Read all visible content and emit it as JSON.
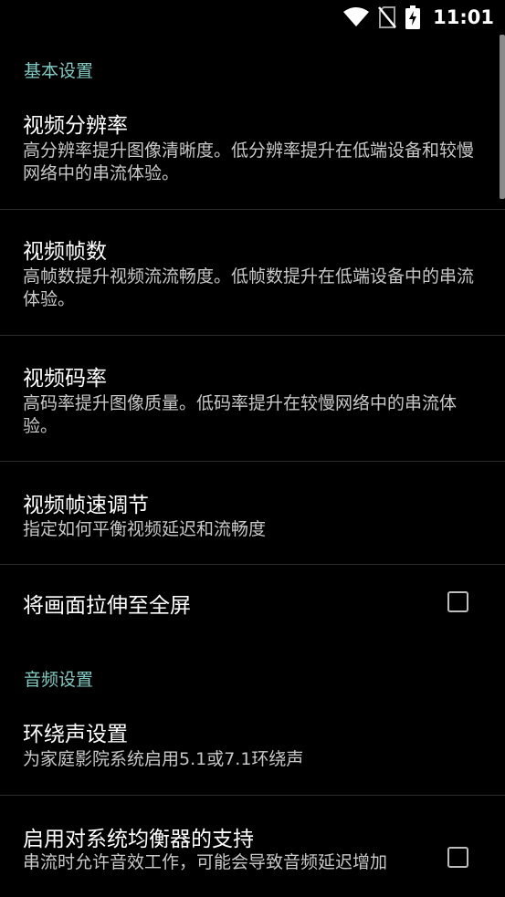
{
  "status_bar": {
    "time": "11:01",
    "icons": [
      "wifi-icon",
      "no-sim-icon",
      "battery-charging-icon"
    ]
  },
  "categories": {
    "basic": "基本设置",
    "audio": "音频设置"
  },
  "prefs": {
    "resolution": {
      "title": "视频分辨率",
      "summary": "高分辨率提升图像清晰度。低分辨率提升在低端设备和较慢网络中的串流体验。"
    },
    "fps": {
      "title": "视频帧数",
      "summary": "高帧数提升视频流流畅度。低帧数提升在低端设备中的串流体验。"
    },
    "bitrate": {
      "title": "视频码率",
      "summary": "高码率提升图像质量。低码率提升在较慢网络中的串流体验。"
    },
    "frame_pacing": {
      "title": "视频帧速调节",
      "summary": "指定如何平衡视频延迟和流畅度"
    },
    "stretch": {
      "title": "将画面拉伸至全屏",
      "checked": false
    },
    "surround": {
      "title": "环绕声设置",
      "summary": "为家庭影院系统启用5.1或7.1环绕声"
    },
    "equalizer": {
      "title": "启用对系统均衡器的支持",
      "summary": "串流时允许音效工作，可能会导致音频延迟增加",
      "checked": false
    }
  },
  "colors": {
    "background": "#000000",
    "accent": "#80cbc4",
    "summary_text": "#c8c8c8"
  }
}
